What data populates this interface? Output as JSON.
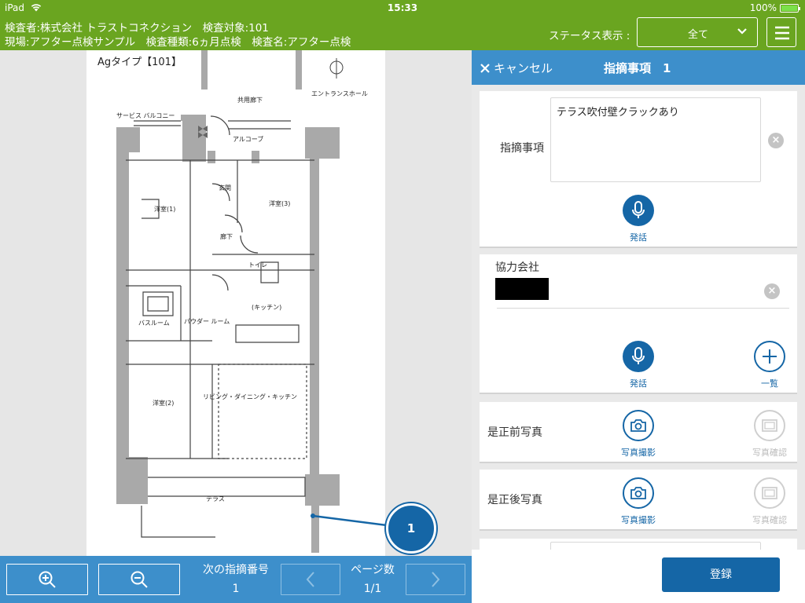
{
  "status_bar": {
    "device": "iPad",
    "time": "15:33",
    "battery": "100%"
  },
  "header": {
    "line1": "検査者:株式会社 トラストコネクション　検査対象:101",
    "line2": "現場:アフター点検サンプル　検査種類:6ヵ月点検　検査名:アフター点検",
    "status_label": "ステータス表示 :",
    "status_value": "全て"
  },
  "plan": {
    "title": "Agタイプ【101】",
    "rooms": {
      "common_corridor": "共用廊下",
      "entrance_hall": "エントランスホール",
      "service_balcony": "サービス\nバルコニー",
      "alcove": "アルコーブ",
      "western1": "洋室(1)",
      "western2": "洋室(2)",
      "western3": "洋室(3)",
      "corridor": "廊下",
      "entrance": "玄関",
      "toilet": "トイレ",
      "kitchen": "(キッチン)",
      "bathroom": "バスルーム",
      "powder": "パウダー\nルーム",
      "ldk": "リビング・ダイニング・キッチン",
      "terrace": "テラス"
    },
    "marker": "1"
  },
  "toolbar": {
    "next_label": "次の指摘番号",
    "next_value": "1",
    "page_label": "ページ数",
    "page_value": "1/1"
  },
  "panel": {
    "cancel": "キャンセル",
    "title": "指摘事項　1",
    "issue_label": "指摘事項",
    "issue_text": "テラス吹付壁クラックあり",
    "speak": "発話",
    "partner_label": "協力会社",
    "list": "一覧",
    "before_label": "是正前写真",
    "after_label": "是正後写真",
    "take_photo": "写真撮影",
    "view_photo": "写真確認"
  },
  "footer": {
    "submit": "登録"
  },
  "colors": {
    "header_green": "#6aa520",
    "accent_blue": "#3d8fcb",
    "button_blue": "#1566a6"
  }
}
